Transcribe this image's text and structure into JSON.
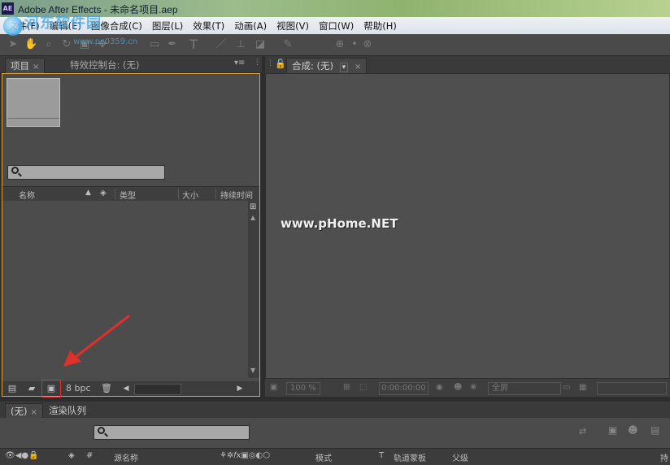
{
  "window": {
    "icon_text": "AE",
    "title": "Adobe After Effects - 未命名项目.aep"
  },
  "watermark": {
    "site_text": "河东软件园",
    "url": "www.pc0359.cn",
    "overlay": "www.pHome.NET"
  },
  "menu": {
    "items": [
      "文件(F)",
      "编辑(E)",
      "图像合成(C)",
      "图层(L)",
      "效果(T)",
      "动画(A)",
      "视图(V)",
      "窗口(W)",
      "帮助(H)"
    ]
  },
  "project_panel": {
    "tab_project": "项目",
    "tab_effects": "特效控制台: (无)",
    "columns": [
      "名称",
      "类型",
      "大小",
      "持续时间"
    ],
    "bit_depth": "8 bpc"
  },
  "comp_panel": {
    "tab_label": "合成: (无)",
    "zoom": "100 %",
    "timecode": "0:00:00:00",
    "resolution": "全屏"
  },
  "timeline": {
    "tab_none": "(无)",
    "tab_render": "渲染队列",
    "columns": [
      "#",
      "源名称",
      "模式",
      "T",
      "轨道蒙板",
      "父级",
      "持"
    ]
  }
}
